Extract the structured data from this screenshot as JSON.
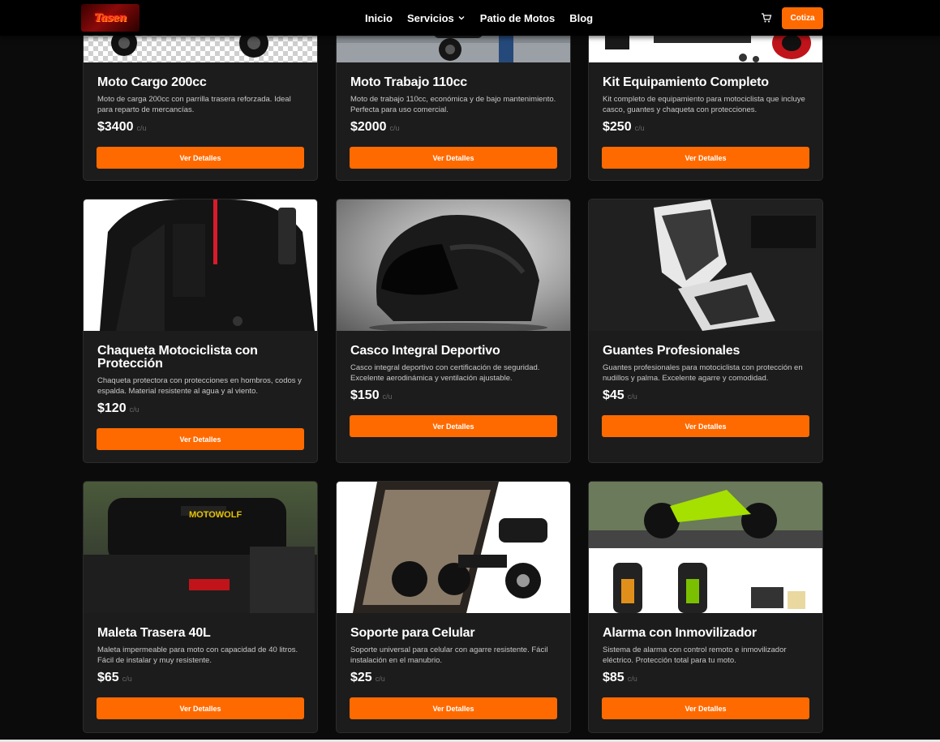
{
  "nav": {
    "logo_text": "Tasen",
    "links": [
      "Inicio",
      "Servicios",
      "Patio de Motos",
      "Blog"
    ],
    "cta_label": "Cotiza"
  },
  "colors": {
    "accent": "#ff6a00",
    "card_bg": "#1c1c1c",
    "page_bg": "#0b0b0b"
  },
  "products": [
    {
      "title": "Moto Cargo 200cc",
      "description": "Moto de carga 200cc con parrilla trasera reforzada. Ideal para reparto de mercancías.",
      "price": "$3400",
      "unit": "c/u",
      "button": "Ver Detalles",
      "image_icon": "cargo-motorcycle-icon"
    },
    {
      "title": "Moto Trabajo 110cc",
      "description": "Moto de trabajo 110cc, económica y de bajo mantenimiento. Perfecta para uso comercial.",
      "price": "$2000",
      "unit": "c/u",
      "button": "Ver Detalles",
      "image_icon": "scooter-icon"
    },
    {
      "title": "Kit Equipamiento Completo",
      "description": "Kit completo de equipamiento para motociclista que incluye casco, guantes y chaqueta con protecciones.",
      "price": "$250",
      "unit": "c/u",
      "button": "Ver Detalles",
      "image_icon": "gear-kit-icon"
    },
    {
      "title": "Chaqueta Motociclista con Protección",
      "description": "Chaqueta protectora con protecciones en hombros, codos y espalda. Material resistente al agua y al viento.",
      "price": "$120",
      "unit": "c/u",
      "button": "Ver Detalles",
      "image_icon": "jacket-icon"
    },
    {
      "title": "Casco Integral Deportivo",
      "description": "Casco integral deportivo con certificación de seguridad. Excelente aerodinámica y ventilación ajustable.",
      "price": "$150",
      "unit": "c/u",
      "button": "Ver Detalles",
      "image_icon": "helmet-icon"
    },
    {
      "title": "Guantes Profesionales",
      "description": "Guantes profesionales para motociclista con protección en nudillos y palma. Excelente agarre y comodidad.",
      "price": "$45",
      "unit": "c/u",
      "button": "Ver Detalles",
      "image_icon": "gloves-icon"
    },
    {
      "title": "Maleta Trasera 40L",
      "description": "Maleta impermeable para moto con capacidad de 40 litros. Fácil de instalar y muy resistente.",
      "price": "$65",
      "unit": "c/u",
      "button": "Ver Detalles",
      "image_icon": "tail-bag-icon"
    },
    {
      "title": "Soporte para Celular",
      "description": "Soporte universal para celular con agarre resistente. Fácil instalación en el manubrio.",
      "price": "$25",
      "unit": "c/u",
      "button": "Ver Detalles",
      "image_icon": "phone-mount-icon"
    },
    {
      "title": "Alarma con Inmovilizador",
      "description": "Sistema de alarma con control remoto e inmovilizador eléctrico. Protección total para tu moto.",
      "price": "$85",
      "unit": "c/u",
      "button": "Ver Detalles",
      "image_icon": "alarm-remote-icon"
    }
  ]
}
